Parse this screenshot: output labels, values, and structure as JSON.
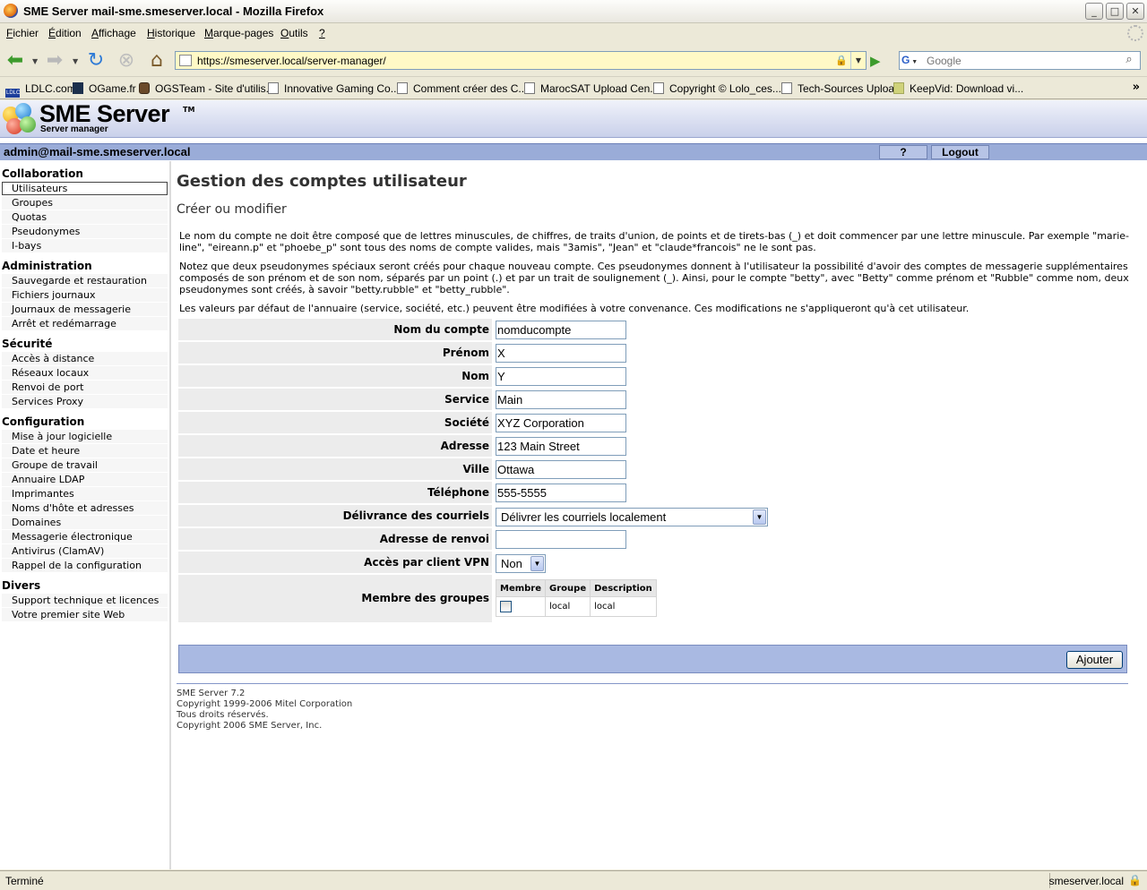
{
  "window": {
    "title": "SME Server mail-sme.smeserver.local - Mozilla Firefox",
    "minimize": "_",
    "maximize": "□",
    "close": "✕"
  },
  "menu": {
    "items": [
      {
        "pre": "",
        "u": "F",
        "post": "ichier"
      },
      {
        "pre": "",
        "u": "É",
        "post": "dition"
      },
      {
        "pre": "",
        "u": "A",
        "post": "ffichage"
      },
      {
        "pre": "",
        "u": "H",
        "post": "istorique"
      },
      {
        "pre": "",
        "u": "M",
        "post": "arque-pages"
      },
      {
        "pre": "",
        "u": "O",
        "post": "utils"
      },
      {
        "pre": "",
        "u": "?",
        "post": ""
      }
    ]
  },
  "nav": {
    "url": "https://smeserver.local/server-manager/",
    "search_placeholder": "Google",
    "search_engine": "G"
  },
  "bookmarks": [
    {
      "label": "LDLC.com",
      "icon": "ldlc"
    },
    {
      "label": "OGame.fr",
      "icon": "ogame"
    },
    {
      "label": "OGSTeam - Site d'utilis...",
      "icon": "ogs"
    },
    {
      "label": "Innovative Gaming Co...",
      "icon": "page"
    },
    {
      "label": "Comment créer des C...",
      "icon": "page"
    },
    {
      "label": "MarocSAT Upload Cen...",
      "icon": "page"
    },
    {
      "label": "Copyright © Lolo_ces...",
      "icon": "page"
    },
    {
      "label": "Tech-Sources Upload",
      "icon": "page"
    },
    {
      "label": "KeepVid: Download vi...",
      "icon": "keep"
    }
  ],
  "header": {
    "logo_text": "SME Server",
    "logo_sub": "Server manager",
    "logo_tm": "TM"
  },
  "admin": {
    "user": "admin@mail-sme.smeserver.local",
    "help": "?",
    "logout": "Logout"
  },
  "sidebar": {
    "sections": [
      {
        "title": "Collaboration",
        "items": [
          "Utilisateurs",
          "Groupes",
          "Quotas",
          "Pseudonymes",
          "I-bays"
        ]
      },
      {
        "title": "Administration",
        "items": [
          "Sauvegarde et restauration",
          "Fichiers journaux",
          "Journaux de messagerie",
          "Arrêt et redémarrage"
        ]
      },
      {
        "title": "Sécurité",
        "items": [
          "Accès à distance",
          "Réseaux locaux",
          "Renvoi de port",
          "Services Proxy"
        ]
      },
      {
        "title": "Configuration",
        "items": [
          "Mise à jour logicielle",
          "Date et heure",
          "Groupe de travail",
          "Annuaire LDAP",
          "Imprimantes",
          "Noms d'hôte et adresses",
          "Domaines",
          "Messagerie électronique",
          "Antivirus (ClamAV)",
          "Rappel de la configuration"
        ]
      },
      {
        "title": "Divers",
        "items": [
          "Support technique et licences",
          "Votre premier site Web"
        ]
      }
    ],
    "active": "Utilisateurs"
  },
  "main": {
    "title": "Gestion des comptes utilisateur",
    "subtitle": "Créer ou modifier",
    "para1": "Le nom du compte ne doit être composé que de lettres minuscules, de chiffres, de traits d'union, de points et de tirets-bas (_) et doit commencer par une lettre minuscule. Par exemple \"marie-line\", \"eireann.p\" et \"phoebe_p\" sont tous des noms de compte valides, mais \"3amis\", \"Jean\" et \"claude*francois\" ne le sont pas.",
    "para2": "Notez que deux pseudonymes spéciaux seront créés pour chaque nouveau compte. Ces pseudonymes donnent à l'utilisateur la possibilité d'avoir des comptes de messagerie supplémentaires composés de son prénom et de son nom, séparés par un point (.) et par un trait de soulignement (_). Ainsi, pour le compte \"betty\", avec \"Betty\" comme prénom et \"Rubble\" comme nom, deux pseudonymes sont créés, à savoir \"betty.rubble\" et \"betty_rubble\".",
    "para3": "Les valeurs par défaut de l'annuaire (service, société, etc.) peuvent être modifiées à votre convenance. Ces modifications ne s'appliqueront qu'à cet utilisateur.",
    "fields": [
      {
        "label": "Nom du compte",
        "value": "nomducompte"
      },
      {
        "label": "Prénom",
        "value": "X"
      },
      {
        "label": "Nom",
        "value": "Y"
      },
      {
        "label": "Service",
        "value": "Main"
      },
      {
        "label": "Société",
        "value": "XYZ Corporation"
      },
      {
        "label": "Adresse",
        "value": "123 Main Street"
      },
      {
        "label": "Ville",
        "value": "Ottawa"
      },
      {
        "label": "Téléphone",
        "value": "555-5555"
      }
    ],
    "delivery_label": "Délivrance des courriels",
    "delivery_value": "Délivrer les courriels localement",
    "forward_label": "Adresse de renvoi",
    "forward_value": "",
    "vpn_label": "Accès par client VPN",
    "vpn_value": "Non",
    "groups_label": "Membre des groupes",
    "groups_headers": [
      "Membre",
      "Groupe",
      "Description"
    ],
    "groups_rows": [
      {
        "member": false,
        "group": "local",
        "description": "local"
      }
    ],
    "add_button": "Ajouter",
    "footer": [
      "SME Server 7.2",
      "Copyright 1999-2006 Mitel Corporation",
      "Tous droits réservés.",
      "Copyright 2006 SME Server, Inc."
    ]
  },
  "status": {
    "text": "Terminé",
    "domain": "smeserver.local"
  }
}
